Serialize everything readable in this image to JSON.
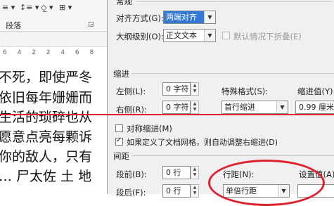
{
  "word": {
    "ribbon": {
      "paragraph_group_label": "段落",
      "line_spacing_icon": "line-spacing-icon",
      "shading_icon": "shading-icon",
      "borders_icon": "borders-icon",
      "dialog_launcher_icon": "dialog-launcher-icon"
    },
    "ruler_text": "6 4 2   2 4 6 8",
    "document_lines": [
      "不死，即使严冬",
      "依旧每年姗姗而",
      "生活的琐碎也从",
      "愿意点亮每颗诉",
      "你的敌人，只有",
      "…  尸太佐 土 地"
    ]
  },
  "dialog": {
    "general": {
      "section_label": "常规",
      "alignment_label": "对齐方式(G):",
      "alignment_value": "两端对齐",
      "outline_label": "大纲级别(O):",
      "outline_value": "正文文本",
      "collapse_label": "默认情况下折叠(E)"
    },
    "indent": {
      "section_label": "缩进",
      "left_label": "左侧(L):",
      "left_value": "0 字符",
      "right_label": "右侧(R):",
      "right_value": "0 字符",
      "special_label": "特殊格式(S):",
      "special_value": "首行缩进",
      "by_label": "缩进值(Y):",
      "by_value": "0.99 厘米",
      "mirror_label": "对称缩进(M)",
      "auto_adjust_label": "如果定义了文档网格，则自动调整右缩进(D)"
    },
    "spacing": {
      "section_label": "间距",
      "before_label": "段前(B):",
      "before_value": "0 行",
      "after_label": "段后(F):",
      "after_value": "0 行",
      "line_label": "行距(N):",
      "line_value": "单倍行距",
      "at_label": "设置值(A):"
    }
  },
  "colors": {
    "annotation_red": "#e0212d",
    "selection_blue": "#3478d6"
  }
}
